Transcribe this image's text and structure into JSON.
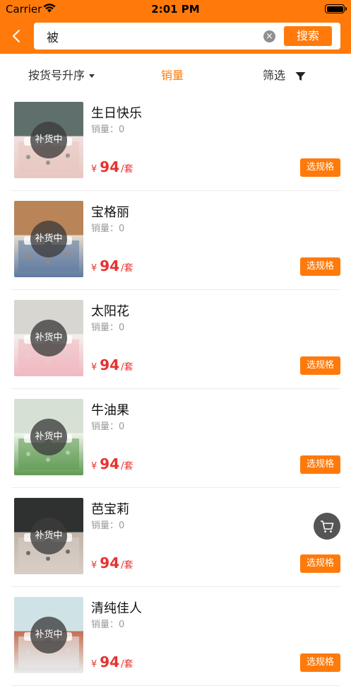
{
  "status": {
    "carrier": "Carrier",
    "time": "2:01 PM"
  },
  "search": {
    "value": "被",
    "button": "搜索"
  },
  "filters": {
    "sort": "按货号升序",
    "sales": "销量",
    "filter": "筛选"
  },
  "colors": {
    "brand": "#ff7a0a",
    "price": "#e8322f"
  },
  "products": [
    {
      "name": "生日快乐",
      "sales_label": "销量：",
      "sales": "0",
      "currency": "¥",
      "price": "94",
      "unit": "/套",
      "badge": "补货中",
      "action": "选规格",
      "palette": [
        "#5f6f6c",
        "#f0e0e0",
        "#e8c7c0"
      ]
    },
    {
      "name": "宝格丽",
      "sales_label": "销量：",
      "sales": "0",
      "currency": "¥",
      "price": "94",
      "unit": "/套",
      "badge": "补货中",
      "action": "选规格",
      "palette": [
        "#b98458",
        "#e6dcd0",
        "#5e7aa0"
      ]
    },
    {
      "name": "太阳花",
      "sales_label": "销量：",
      "sales": "0",
      "currency": "¥",
      "price": "94",
      "unit": "/套",
      "badge": "补货中",
      "action": "选规格",
      "palette": [
        "#d8d6d0",
        "#f3f0ee",
        "#f0b8c0"
      ]
    },
    {
      "name": "牛油果",
      "sales_label": "销量：",
      "sales": "0",
      "currency": "¥",
      "price": "94",
      "unit": "/套",
      "badge": "补货中",
      "action": "选规格",
      "palette": [
        "#d6e1d4",
        "#f0f4ec",
        "#5f9a52"
      ]
    },
    {
      "name": "芭宝莉",
      "sales_label": "销量：",
      "sales": "0",
      "currency": "¥",
      "price": "94",
      "unit": "/套",
      "badge": "补货中",
      "action": "选规格",
      "palette": [
        "#2e3130",
        "#bfb3a6",
        "#d8cec6"
      ]
    },
    {
      "name": "清纯佳人",
      "sales_label": "销量：",
      "sales": "0",
      "currency": "¥",
      "price": "94",
      "unit": "/套",
      "badge": "补货中",
      "action": "选规格",
      "palette": [
        "#cfe3e6",
        "#c46f52",
        "#e8eef0"
      ]
    }
  ],
  "icons": {
    "back": "chevron-left-icon",
    "clear": "clear-circle-icon",
    "filter": "funnel-icon",
    "cart": "cart-icon"
  }
}
